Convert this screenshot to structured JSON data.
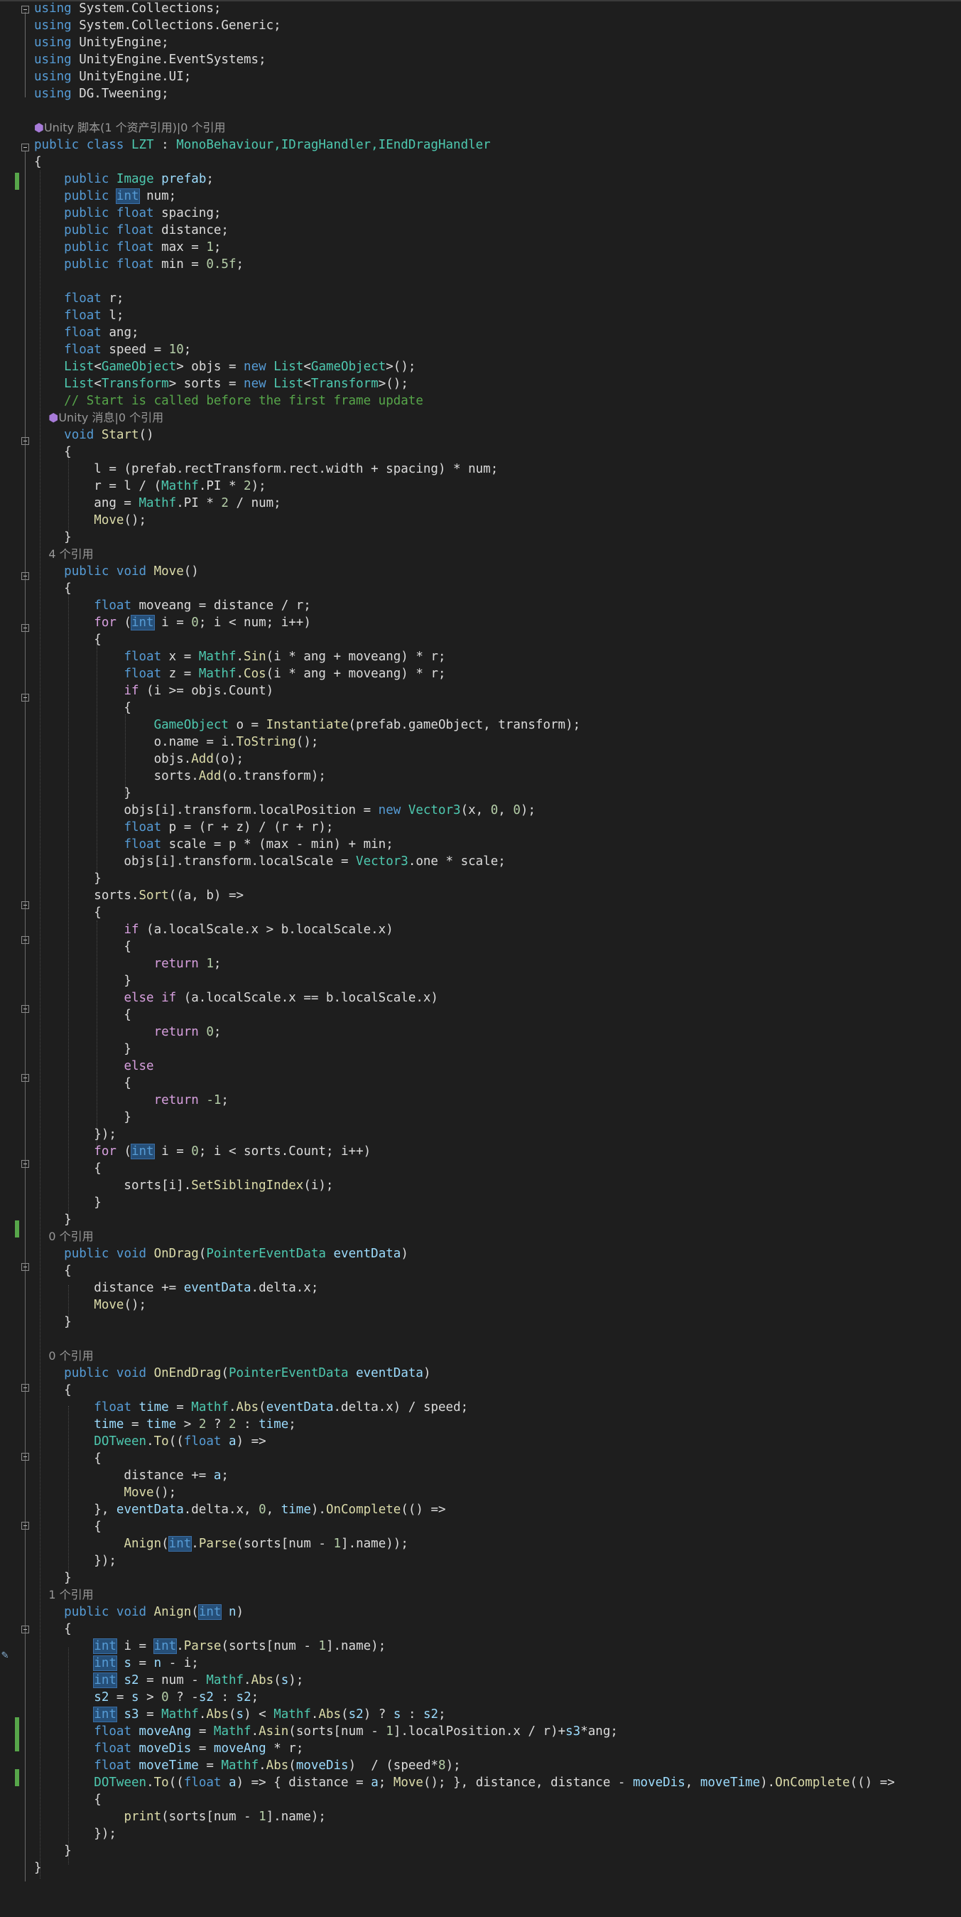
{
  "code": {
    "usings": [
      "System.Collections",
      "System.Collections.Generic",
      "UnityEngine",
      "UnityEngine.EventSystems",
      "UnityEngine.UI",
      "DG.Tweening"
    ],
    "lens_class": "Unity 脚本(1 个资产引用)|0 个引用",
    "class_name": "LZT",
    "base_types": "MonoBehaviour,IDragHandler,IEndDragHandler",
    "comment_start": "// Start is called before the first frame update",
    "lens_start": "Unity 消息|0 个引用",
    "lens_move": "4 个引用",
    "lens_ondrag": "0 个引用",
    "lens_onenddrag": "0 个引用",
    "lens_anign": "1 个引用",
    "status_colors": {
      "changed_bar": "#57a64a",
      "keyword": "#569cd6",
      "type": "#4ec9b0",
      "method": "#dcdcaa",
      "control": "#d8a0df",
      "number": "#b5cea8",
      "comment": "#57a64a"
    }
  }
}
